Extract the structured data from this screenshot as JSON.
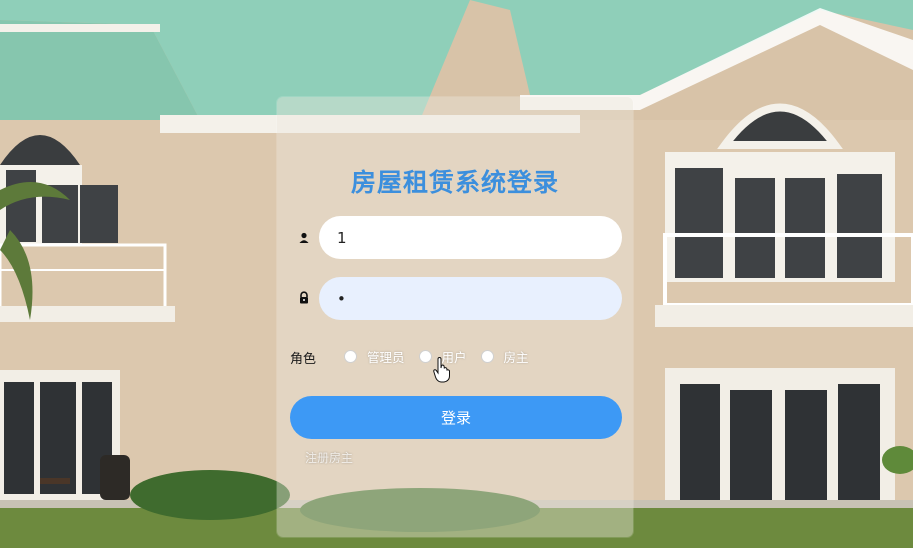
{
  "login": {
    "title": "房屋租赁系统登录",
    "username_value": "1",
    "password_value": "•",
    "role_label": "角色",
    "roles": [
      {
        "label": "管理员"
      },
      {
        "label": "用户"
      },
      {
        "label": "房主"
      }
    ],
    "login_button": "登录",
    "register_link": "注册房主"
  },
  "icons": {
    "username": "user-icon",
    "password": "lock-icon",
    "cursor": "hand-pointer-icon"
  },
  "colors": {
    "title": "#3c8fdd",
    "button": "#3d99f5",
    "roof": "#8fcfb9",
    "wall": "#d9c4aa"
  }
}
